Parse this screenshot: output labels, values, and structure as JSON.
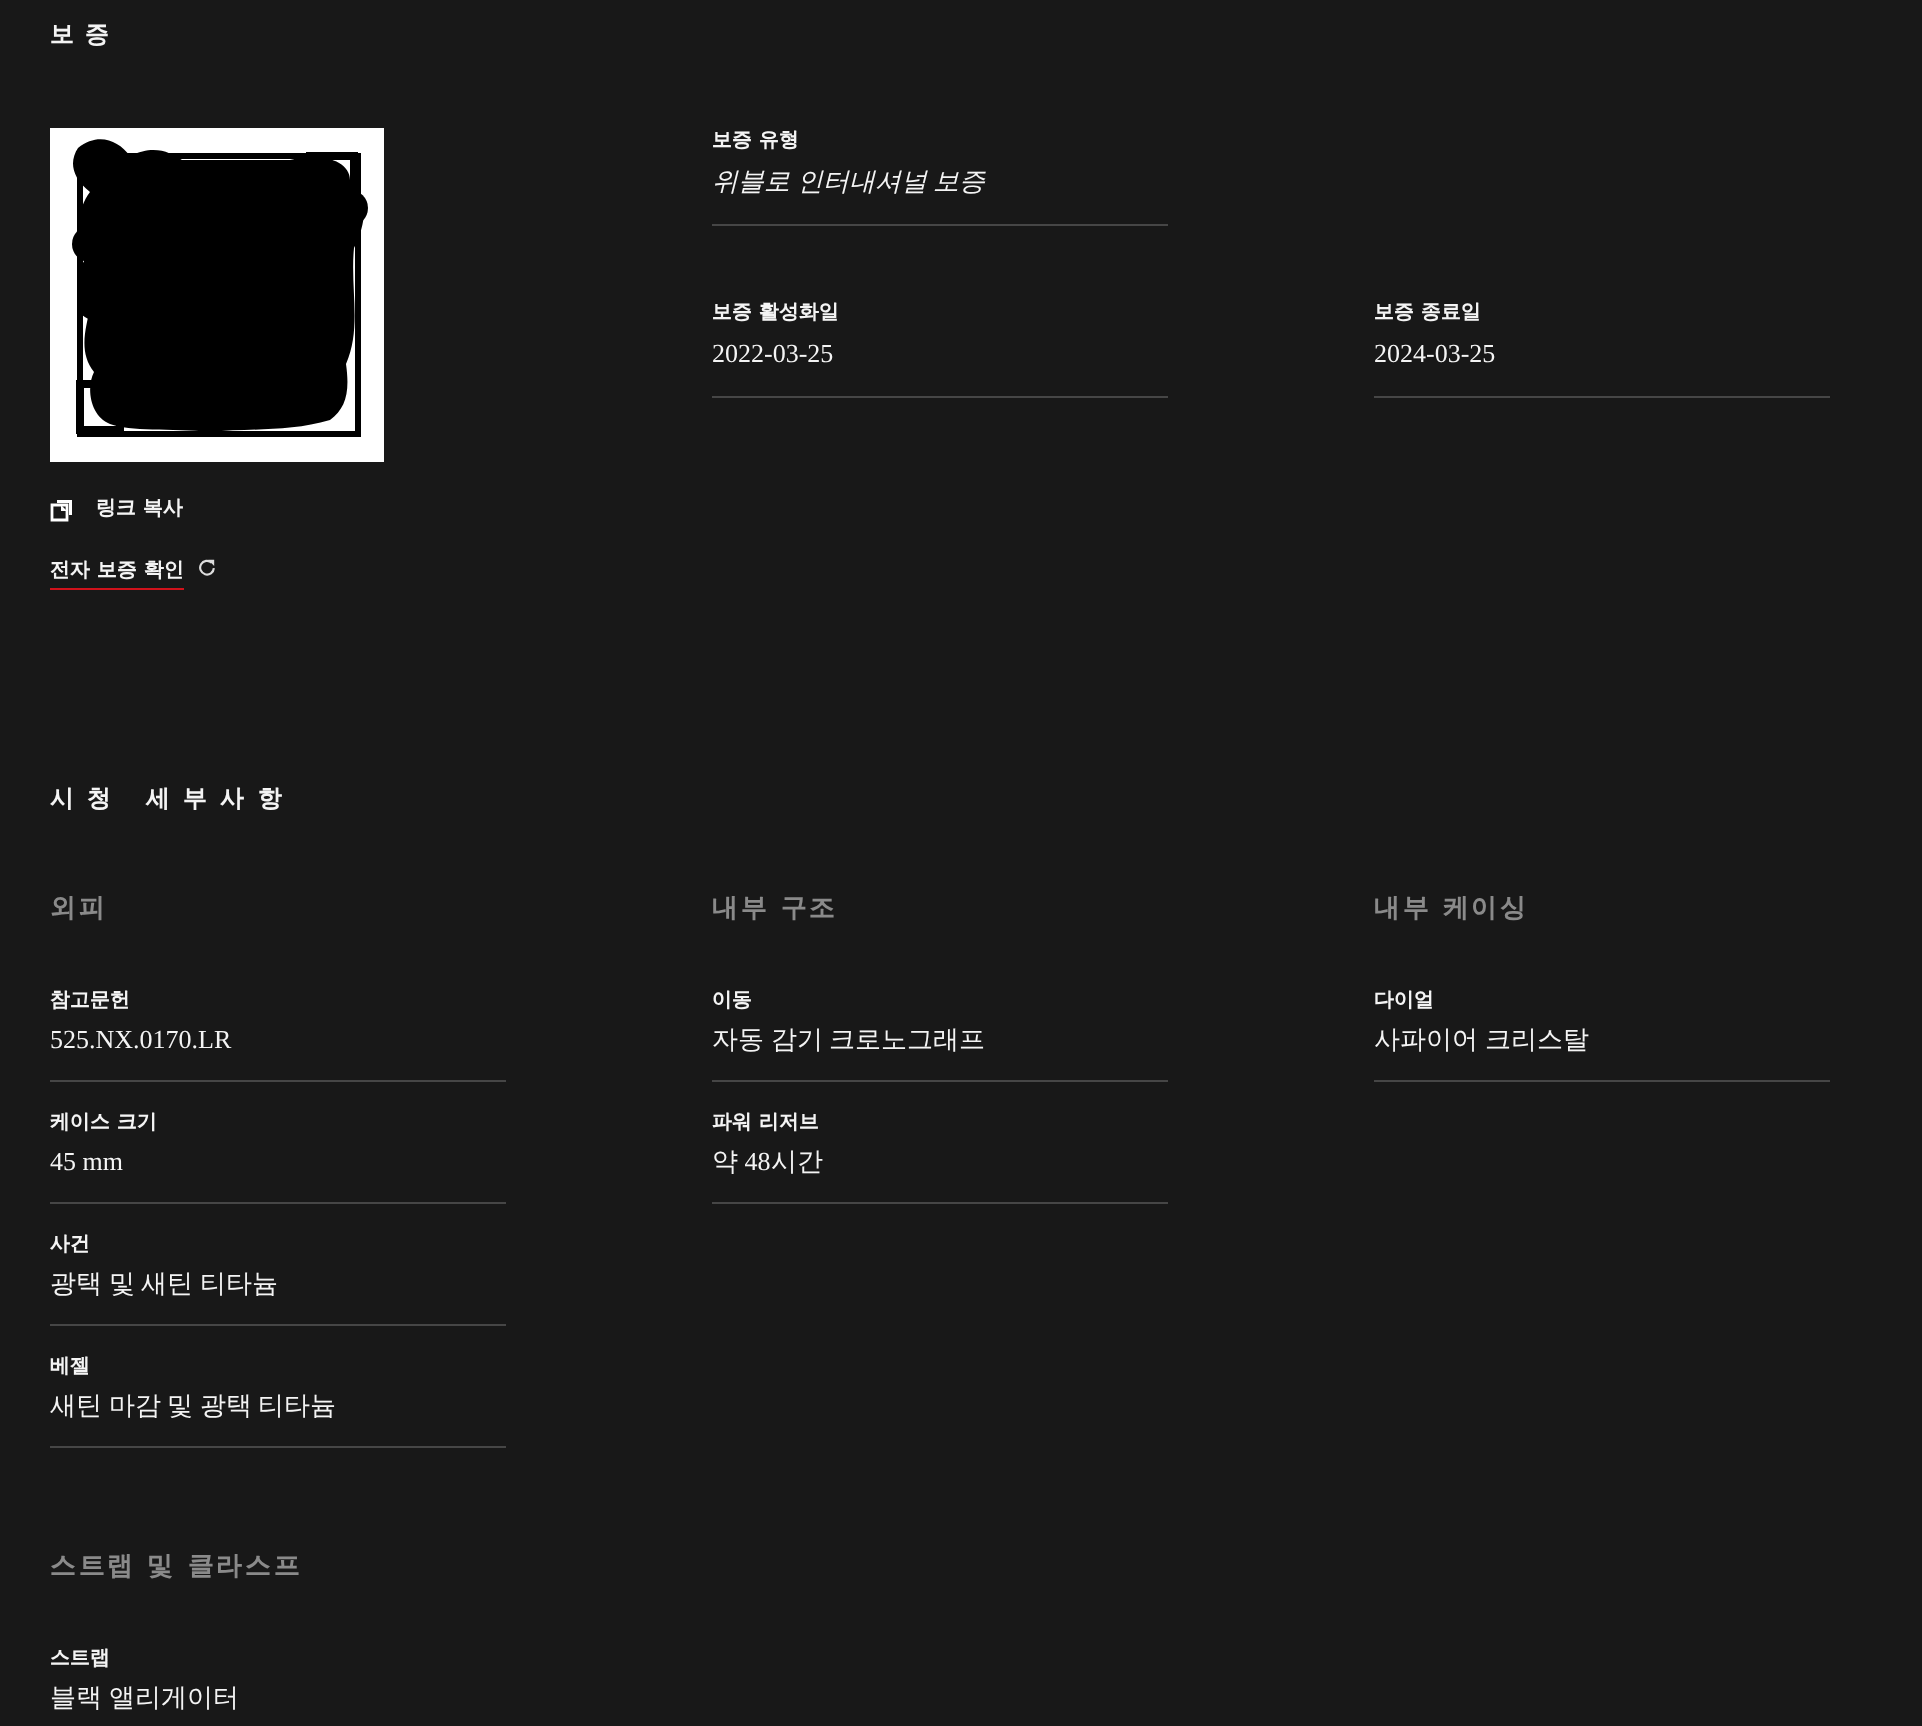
{
  "warranty": {
    "title": "보증",
    "copy_link": {
      "label": "링크 복사"
    },
    "e_warranty_link": {
      "label": "전자 보증 확인"
    },
    "field_rows": [
      [
        {
          "label": "보증 유형",
          "value": "위블로 인터내셔널 보증",
          "italic": true
        }
      ],
      [
        {
          "label": "보증 활성화일",
          "value": "2022-03-25",
          "italic": false
        },
        {
          "label": "보증 종료일",
          "value": "2024-03-25",
          "italic": false
        }
      ]
    ]
  },
  "details": {
    "title": "시청 세부사항",
    "groups": [
      {
        "heading": "외피",
        "items": [
          {
            "label": "참고문헌",
            "value": "525.NX.0170.LR"
          },
          {
            "label": "케이스 크기",
            "value": "45 mm"
          },
          {
            "label": "사건",
            "value": "광택 및 새틴 티타늄"
          },
          {
            "label": "베젤",
            "value": "새틴 마감 및 광택 티타늄"
          }
        ]
      },
      {
        "heading": "내부 구조",
        "items": [
          {
            "label": "이동",
            "value": "자동 감기 크로노그래프"
          },
          {
            "label": "파워 리저브",
            "value": "약 48시간"
          }
        ]
      },
      {
        "heading": "내부 케이싱",
        "items": [
          {
            "label": "다이얼",
            "value": "사파이어 크리스탈"
          }
        ]
      },
      {
        "heading": "스트랩 및 클라스프",
        "items": [
          {
            "label": "스트랩",
            "value": "블랙 앨리게이터"
          }
        ]
      }
    ]
  }
}
